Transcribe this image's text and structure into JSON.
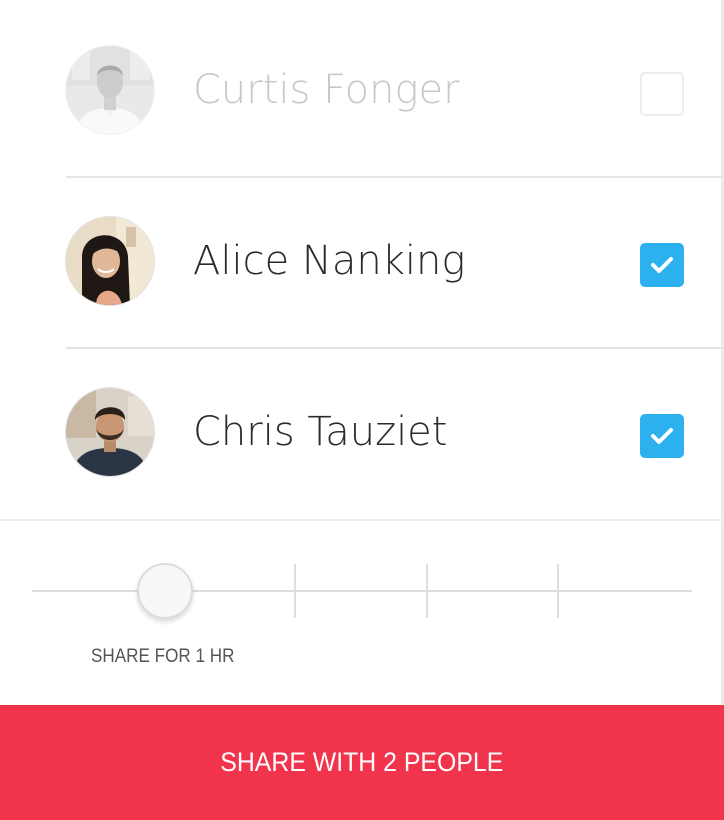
{
  "contacts": [
    {
      "name": "Curtis Fonger",
      "selected": false,
      "enabled": false,
      "avatar_icon": "person-photo-man-white-shirt"
    },
    {
      "name": "Alice Nanking",
      "selected": true,
      "enabled": true,
      "avatar_icon": "person-photo-woman-long-hair"
    },
    {
      "name": "Chris Tauziet",
      "selected": true,
      "enabled": true,
      "avatar_icon": "person-photo-man-beard"
    }
  ],
  "slider": {
    "label": "SHARE FOR 1 HR",
    "selected_step": 1,
    "total_steps": 5
  },
  "share_button": {
    "label": "SHARE WITH 2 PEOPLE"
  },
  "colors": {
    "accent_red": "#f1344c",
    "checkbox_blue": "#2cb1ee",
    "divider": "#e4e4e4",
    "name_text": "#2b2b2b",
    "disabled_text": "#c8c8c8"
  }
}
